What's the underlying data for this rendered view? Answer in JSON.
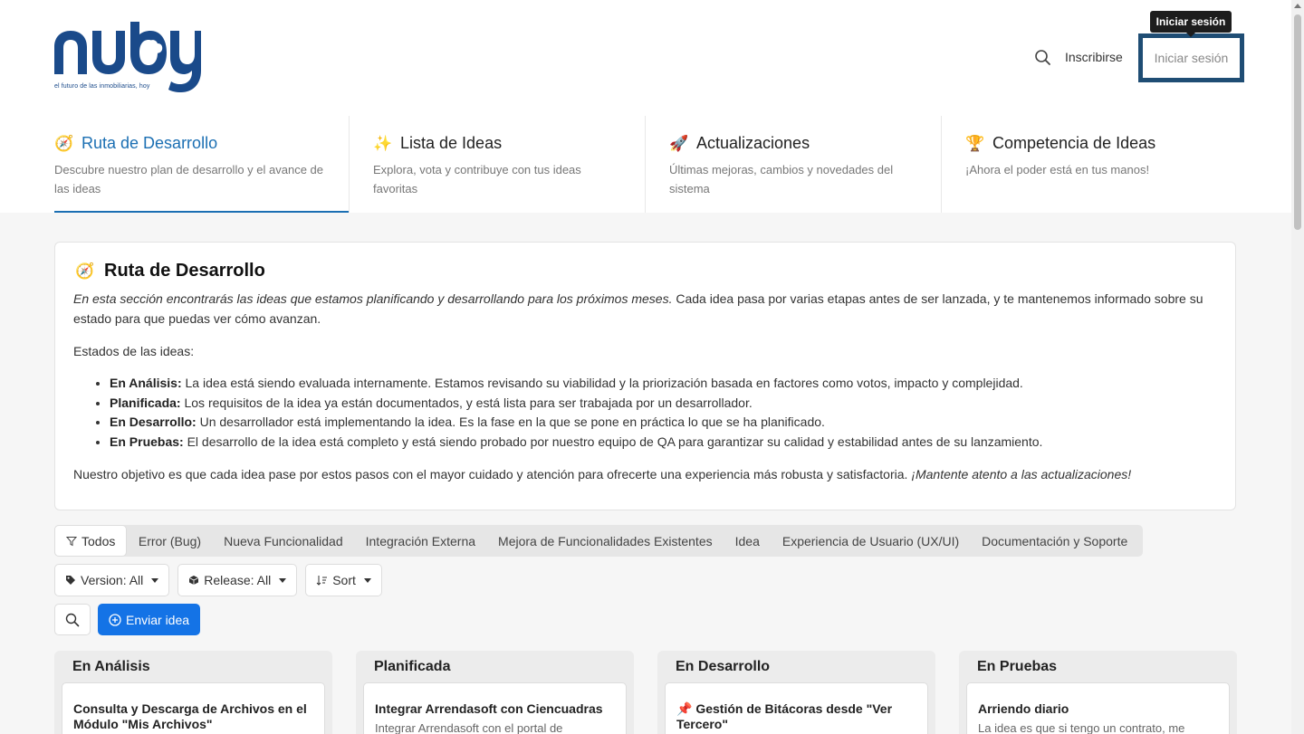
{
  "brand": {
    "logo_text": "nuby",
    "tagline": "el futuro de las inmobiliarias, hoy",
    "color": "#1a4a8a"
  },
  "header": {
    "search_icon": "search-icon",
    "signup_label": "Inscribirse",
    "login_label": "Iniciar sesión",
    "tooltip": "Iniciar sesión"
  },
  "nav": {
    "tabs": [
      {
        "emoji": "🧭",
        "label": "Ruta de Desarrollo",
        "desc_line1": "Descubre nuestro plan de desarrollo y el avance de",
        "desc_line2": "las ideas"
      },
      {
        "emoji": "✨",
        "label": "Lista de Ideas",
        "desc_line1": "Explora, vota y contribuye con tus ideas",
        "desc_line2": "favoritas"
      },
      {
        "emoji": "🚀",
        "label": "Actualizaciones",
        "desc_line1": "Últimas mejoras, cambios y novedades del",
        "desc_line2": "sistema"
      },
      {
        "emoji": "🏆",
        "label": "Competencia de Ideas",
        "desc_line1": "¡Ahora el poder está en tus manos!",
        "desc_line2": ""
      }
    ]
  },
  "intro": {
    "emoji": "🧭",
    "title": "Ruta de Desarrollo",
    "lead_italic": "En esta sección encontrarás las ideas que estamos planificando y desarrollando para los próximos meses.",
    "lead_rest": " Cada idea pasa por varias etapas antes de ser lanzada, y te mantenemos informado sobre su estado para que puedas ver cómo avanzan.",
    "states_title": "Estados de las ideas:",
    "states": [
      {
        "name": "En Análisis:",
        "desc": " La idea está siendo evaluada internamente. Estamos revisando su viabilidad y la priorización basada en factores como votos, impacto y complejidad."
      },
      {
        "name": "Planificada:",
        "desc": " Los requisitos de la idea ya están documentados, y está lista para ser trabajada por un desarrollador."
      },
      {
        "name": "En Desarrollo:",
        "desc": " Un desarrollador está implementando la idea. Es la fase en la que se pone en práctica lo que se ha planificado."
      },
      {
        "name": "En Pruebas:",
        "desc": " El desarrollo de la idea está completo y está siendo probado por nuestro equipo de QA para garantizar su calidad y estabilidad antes de su lanzamiento."
      }
    ],
    "outro": "Nuestro objetivo es que cada idea pase por estos pasos con el mayor cuidado y atención para ofrecerte una experiencia más robusta y satisfactoria. ",
    "outro_italic": "¡Mantente atento a las actualizaciones!"
  },
  "filters": [
    "Todos",
    "Error (Bug)",
    "Nueva Funcionalidad",
    "Integración Externa",
    "Mejora de Funcionalidades Existentes",
    "Idea",
    "Experiencia de Usuario (UX/UI)",
    "Documentación y Soporte"
  ],
  "dropdowns": {
    "version": "Version: All",
    "release": "Release: All",
    "sort": "Sort"
  },
  "actions": {
    "submit_label": "Enviar idea",
    "accent": "#1473e6"
  },
  "columns": [
    {
      "title": "En Análisis",
      "card_line1": "Consulta y Descarga de Archivos en el",
      "card_line2": "Módulo \"Mis Archivos\"",
      "card_desc": ""
    },
    {
      "title": "Planificada",
      "card_line1": "Integrar Arrendasoft con Ciencuadras",
      "card_line2": "",
      "card_desc": "Integrar Arrendasoft con el portal de"
    },
    {
      "title": "En Desarrollo",
      "card_line1": "📌 Gestión de Bitácoras desde \"Ver",
      "card_line2": "Tercero\"",
      "card_desc": ""
    },
    {
      "title": "En Pruebas",
      "card_line1": "Arriendo diario",
      "card_line2": "",
      "card_desc": "La idea es que si tengo un contrato, me"
    }
  ]
}
